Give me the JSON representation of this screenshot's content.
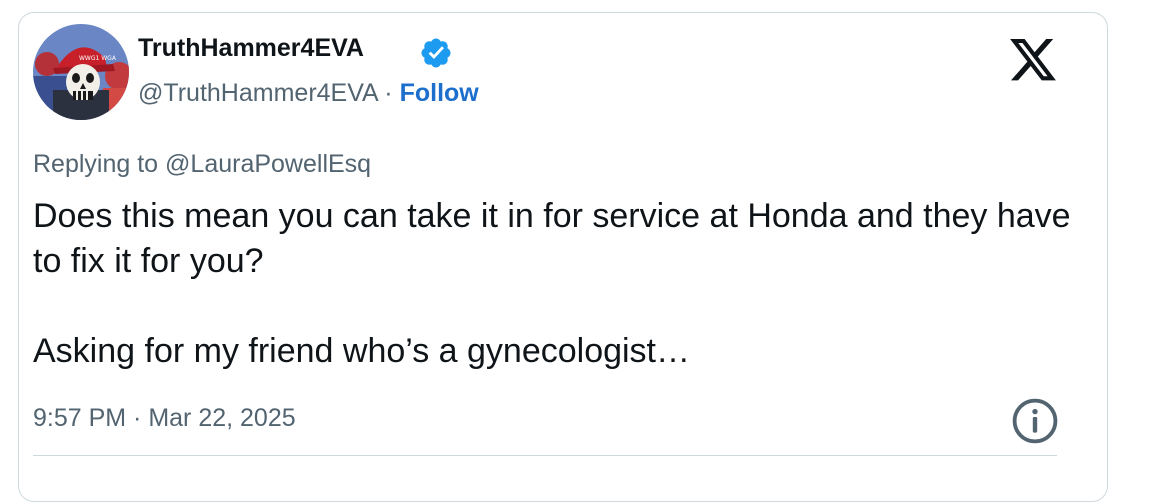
{
  "author": {
    "display_name": "TruthHammer4EVA",
    "handle": "@TruthHammer4EVA",
    "separator": "·",
    "follow_label": "Follow",
    "verified_icon": "verified-badge-icon",
    "avatar_hat_text": "WWG1 WGA"
  },
  "reply": {
    "prefix": "Replying to",
    "to_handle": "@LauraPowellEsq"
  },
  "tweet": {
    "line1": "Does this mean you can take it in for service at Honda and they have to fix it for you?",
    "line2": "Asking for my friend who’s a gynecologist…"
  },
  "meta": {
    "timestamp": "9:57 PM · Mar 22, 2025"
  },
  "icons": {
    "platform": "x-logo-icon",
    "info": "info-icon"
  },
  "colors": {
    "text": "#0f1419",
    "secondary": "#536471",
    "link": "#1d6fce",
    "verified": "#1d9bf0",
    "border": "#cfd9de"
  }
}
